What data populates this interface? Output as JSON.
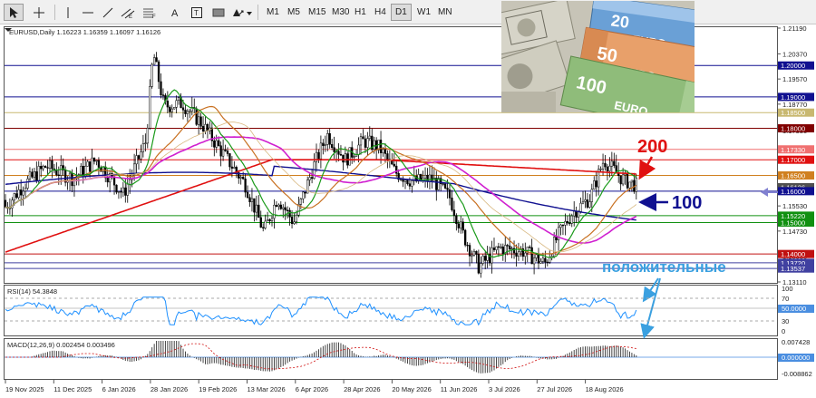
{
  "toolbar": {
    "timeframes": [
      "M1",
      "M5",
      "M15",
      "M30",
      "H1",
      "H4",
      "D1",
      "W1",
      "MN"
    ],
    "active_timeframe": "D1"
  },
  "chart_data": [
    {
      "type": "candlestick",
      "title": "EURUSD,Daily  1.16223 1.16359 1.16097 1.16126",
      "series": [
        {
          "name": "MA 200",
          "color": "#e01010"
        },
        {
          "name": "MA 100",
          "color": "#101090"
        },
        {
          "name": "magenta MA",
          "color": "#d020d0"
        },
        {
          "name": "green MA",
          "color": "#1a9a1a"
        },
        {
          "name": "orange MA",
          "color": "#c87020"
        }
      ],
      "yticks": [
        "1.21190",
        "1.20370",
        "1.19570",
        "1.18770",
        "1.17930",
        "1.17330",
        "1.16500",
        "1.15530",
        "1.14730",
        "1.13930",
        "1.13110"
      ],
      "price_labels": [
        {
          "value": "1.20000",
          "color": "#101090"
        },
        {
          "value": "1.19000",
          "color": "#101090"
        },
        {
          "value": "1.18500",
          "color": "#c8b870"
        },
        {
          "value": "1.18000",
          "color": "#800000"
        },
        {
          "value": "1.17330",
          "color": "#f07070"
        },
        {
          "value": "1.17000",
          "color": "#e01010"
        },
        {
          "value": "1.16500",
          "color": "#d08020"
        },
        {
          "value": "1.16126",
          "color": "#505050"
        },
        {
          "value": "1.16000",
          "color": "#101090"
        },
        {
          "value": "1.15220",
          "color": "#109010"
        },
        {
          "value": "1.15000",
          "color": "#109010"
        },
        {
          "value": "1.14000",
          "color": "#c01010"
        },
        {
          "value": "1.13720",
          "color": "#4040a0"
        },
        {
          "value": "1.13537",
          "color": "#4040a0"
        }
      ],
      "horizontal_levels": [
        {
          "value": 1.2,
          "color": "#101090"
        },
        {
          "value": 1.19,
          "color": "#101090"
        },
        {
          "value": 1.185,
          "color": "#c8b870"
        },
        {
          "value": 1.18,
          "color": "#800000"
        },
        {
          "value": 1.1733,
          "color": "#f07070"
        },
        {
          "value": 1.17,
          "color": "#e01010"
        },
        {
          "value": 1.165,
          "color": "#d08020"
        },
        {
          "value": 1.16,
          "color": "#101090"
        },
        {
          "value": 1.1522,
          "color": "#109010"
        },
        {
          "value": 1.15,
          "color": "#109010"
        },
        {
          "value": 1.14,
          "color": "#c01010"
        },
        {
          "value": 1.1372,
          "color": "#4040a0"
        },
        {
          "value": 1.1354,
          "color": "#4040a0"
        }
      ],
      "ylim": [
        1.1311,
        1.2119
      ],
      "annotations": [
        {
          "text": "200",
          "color": "#e01010"
        },
        {
          "text": "100",
          "color": "#101090"
        },
        {
          "text": "положительные",
          "color": "#3aa0e0"
        }
      ]
    },
    {
      "type": "line",
      "title": "RSI(14) 54.3848",
      "yticks": [
        "100",
        "70",
        "30",
        "0"
      ],
      "current_label": "50.0000",
      "ylim": [
        0,
        100
      ],
      "levels": [
        70,
        30
      ],
      "color": "#1e90ff"
    },
    {
      "type": "bar",
      "title": "MACD(12,26,9) 0.002454 0.003496",
      "yticks": [
        "0.007428",
        "-0.008862"
      ],
      "current_label": "0.000000",
      "ylim": [
        -0.008862,
        0.007428
      ]
    }
  ],
  "xaxis_labels": [
    "19 Nov 2025",
    "11 Dec 2025",
    "6 Jan 2026",
    "28 Jan 2026",
    "19 Feb 2026",
    "13 Mar 2026",
    "6 Apr 2026",
    "28 Apr 2026",
    "20 May 2026",
    "11 Jun 2026",
    "3 Jul 2026",
    "27 Jul 2026",
    "18 Aug 2026"
  ],
  "photo": {
    "banknotes": [
      {
        "value": "20",
        "word": "EURO"
      },
      {
        "value": "50",
        "word": "EURO"
      },
      {
        "value": "100",
        "word": "EURO"
      }
    ]
  }
}
